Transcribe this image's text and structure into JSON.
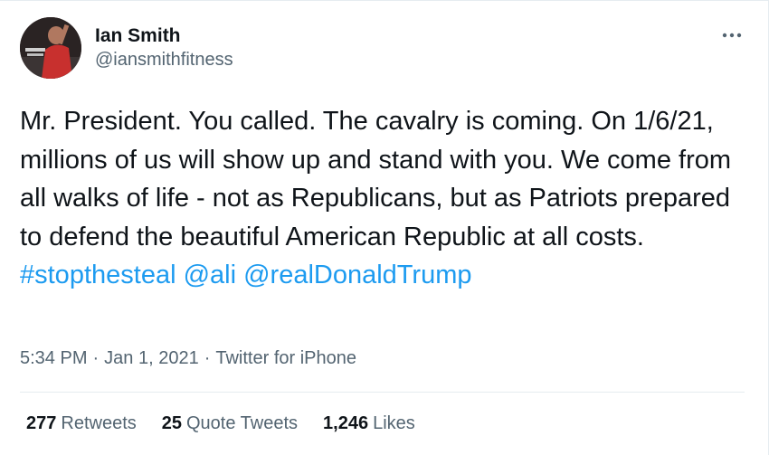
{
  "author": {
    "name": "Ian Smith",
    "handle": "@iansmithfitness"
  },
  "tweet": {
    "text_part1": "Mr. President. You called. The cavalry is coming. On 1/6/21, millions of us will show up and stand with you. We come from all walks of life - not as Republicans, but as Patriots prepared to defend the beautiful American Republic at all costs. ",
    "hashtag": "#stopthesteal",
    "mention1": "@ali",
    "mention2": "@realDonaldTrump"
  },
  "meta": {
    "time": "5:34 PM",
    "separator": "·",
    "date": "Jan 1, 2021",
    "source": "Twitter for iPhone"
  },
  "stats": {
    "retweets_count": "277",
    "retweets_label": "Retweets",
    "quotes_count": "25",
    "quotes_label": "Quote Tweets",
    "likes_count": "1,246",
    "likes_label": "Likes"
  },
  "more_icon": "more-horizontal-icon"
}
